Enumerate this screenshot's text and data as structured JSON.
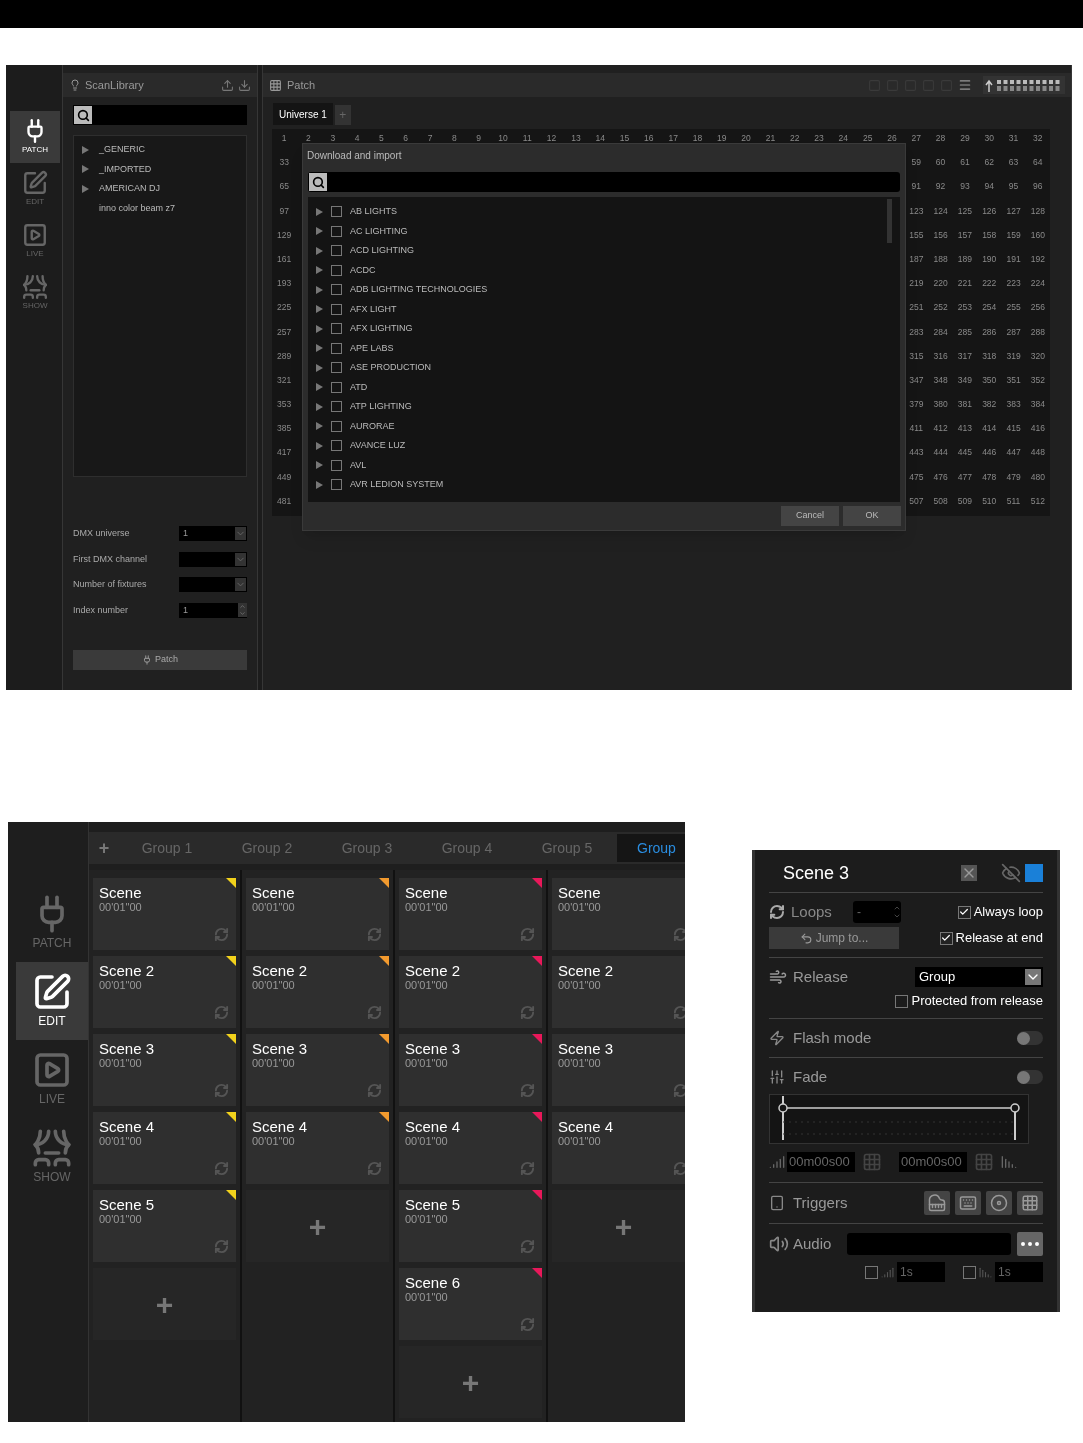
{
  "patch_screen": {
    "nav": [
      {
        "label": "PATCH",
        "selected": true
      },
      {
        "label": "EDIT",
        "selected": false
      },
      {
        "label": "LIVE",
        "selected": false
      },
      {
        "label": "SHOW",
        "selected": false
      }
    ],
    "library": {
      "title": "ScanLibrary",
      "tree": [
        {
          "label": "_GENERIC",
          "expandable": true
        },
        {
          "label": "_IMPORTED",
          "expandable": true
        },
        {
          "label": "AMERICAN DJ",
          "expandable": true
        },
        {
          "label": "inno color beam z7",
          "expandable": false
        }
      ],
      "fields": [
        {
          "label": "DMX universe",
          "value": "1",
          "kind": "dropdown"
        },
        {
          "label": "First DMX channel",
          "kind": "dropdown"
        },
        {
          "label": "Number of fixtures",
          "kind": "dropdown"
        },
        {
          "label": "Index number",
          "value": "1",
          "kind": "spinner"
        }
      ],
      "patch_button": "Patch"
    },
    "patch": {
      "title": "Patch",
      "universe_tabs": [
        {
          "label": "Universe 1",
          "selected": true
        }
      ],
      "add_tab": "+",
      "grid_rows": [
        [
          "1",
          "2",
          "3",
          "4",
          "5",
          "6",
          "7",
          "8",
          "9",
          "10",
          "11",
          "12",
          "13",
          "14",
          "15",
          "16",
          "17",
          "18",
          "19",
          "20",
          "21",
          "22",
          "23",
          "24",
          "25",
          "26",
          "27",
          "28",
          "29",
          "30",
          "31",
          "32"
        ],
        [
          "33",
          "59",
          "60",
          "61",
          "62",
          "63",
          "64"
        ],
        [
          "65",
          "91",
          "92",
          "93",
          "94",
          "95",
          "96"
        ],
        [
          "97",
          "123",
          "124",
          "125",
          "126",
          "127",
          "128"
        ],
        [
          "129",
          "155",
          "156",
          "157",
          "158",
          "159",
          "160"
        ],
        [
          "161",
          "187",
          "188",
          "189",
          "190",
          "191",
          "192"
        ],
        [
          "193",
          "219",
          "220",
          "221",
          "222",
          "223",
          "224"
        ],
        [
          "225",
          "251",
          "252",
          "253",
          "254",
          "255",
          "256"
        ],
        [
          "257",
          "283",
          "284",
          "285",
          "286",
          "287",
          "288"
        ],
        [
          "289",
          "315",
          "316",
          "317",
          "318",
          "319",
          "320"
        ],
        [
          "321",
          "347",
          "348",
          "349",
          "350",
          "351",
          "352"
        ],
        [
          "353",
          "379",
          "380",
          "381",
          "382",
          "383",
          "384"
        ],
        [
          "385",
          "411",
          "412",
          "413",
          "414",
          "415",
          "416"
        ],
        [
          "417",
          "443",
          "444",
          "445",
          "446",
          "447",
          "448"
        ],
        [
          "449",
          "475",
          "476",
          "477",
          "478",
          "479",
          "480"
        ],
        [
          "481",
          "507",
          "508",
          "509",
          "510",
          "511",
          "512"
        ]
      ],
      "dialog": {
        "title": "Download and import",
        "items": [
          {
            "label": "AB LIGHTS",
            "checked": false
          },
          {
            "label": "AC LIGHTING",
            "checked": false
          },
          {
            "label": "ACD LIGHTING",
            "checked": false
          },
          {
            "label": "ACDC",
            "checked": false
          },
          {
            "label": "ADB LIGHTING TECHNOLOGIES",
            "checked": false
          },
          {
            "label": "AFX LIGHT",
            "checked": false
          },
          {
            "label": "AFX LIGHTING",
            "checked": false
          },
          {
            "label": "APE LABS",
            "checked": false
          },
          {
            "label": "ASE PRODUCTION",
            "checked": false
          },
          {
            "label": "ATD",
            "checked": false
          },
          {
            "label": "ATP LIGHTING",
            "checked": false
          },
          {
            "label": "AURORAE",
            "checked": false
          },
          {
            "label": "AVANCE LUZ",
            "checked": false
          },
          {
            "label": "AVL",
            "checked": false
          },
          {
            "label": "AVR LEDION SYSTEM",
            "checked": false
          }
        ],
        "buttons": [
          "Cancel",
          "OK"
        ]
      }
    }
  },
  "scenes_screen": {
    "nav": [
      {
        "label": "PATCH",
        "selected": false
      },
      {
        "label": "EDIT",
        "selected": true
      },
      {
        "label": "LIVE",
        "selected": false
      },
      {
        "label": "SHOW",
        "selected": false
      }
    ],
    "add_group": "+",
    "group_tabs": [
      {
        "label": "Group 1",
        "selected": false
      },
      {
        "label": "Group 2",
        "selected": false
      },
      {
        "label": "Group 3",
        "selected": false
      },
      {
        "label": "Group 4",
        "selected": false
      },
      {
        "label": "Group 5",
        "selected": false
      },
      {
        "label": "Group",
        "selected": true
      }
    ],
    "columns": [
      {
        "color": "#f2d21c",
        "scenes": [
          {
            "name": "Scene",
            "time": "00'01\"00"
          },
          {
            "name": "Scene 2",
            "time": "00'01\"00"
          },
          {
            "name": "Scene 3",
            "time": "00'01\"00"
          },
          {
            "name": "Scene 4",
            "time": "00'01\"00"
          },
          {
            "name": "Scene 5",
            "time": "00'01\"00"
          }
        ],
        "add": "+"
      },
      {
        "color": "#f29a2e",
        "scenes": [
          {
            "name": "Scene",
            "time": "00'01\"00"
          },
          {
            "name": "Scene 2",
            "time": "00'01\"00"
          },
          {
            "name": "Scene 3",
            "time": "00'01\"00"
          },
          {
            "name": "Scene 4",
            "time": "00'01\"00"
          }
        ],
        "add": "+"
      },
      {
        "color": "#e8185a",
        "scenes": [
          {
            "name": "Scene",
            "time": "00'01\"00"
          },
          {
            "name": "Scene 2",
            "time": "00'01\"00"
          },
          {
            "name": "Scene 3",
            "time": "00'01\"00"
          },
          {
            "name": "Scene 4",
            "time": "00'01\"00"
          },
          {
            "name": "Scene 5",
            "time": "00'01\"00"
          },
          {
            "name": "Scene 6",
            "time": "00'01\"00"
          }
        ],
        "add": "+"
      },
      {
        "scenes": [
          {
            "name": "Scene",
            "time": "00'01\"00"
          },
          {
            "name": "Scene 2",
            "time": "00'01\"00"
          },
          {
            "name": "Scene 3",
            "time": "00'01\"00"
          },
          {
            "name": "Scene 4",
            "time": "00'01\"00"
          }
        ],
        "add": "+"
      }
    ]
  },
  "scene_panel": {
    "title": "Scene 3",
    "color": "#1a80d8",
    "loops": {
      "label": "Loops",
      "value": "-",
      "jump_button": "Jump to...",
      "always_loop": {
        "label": "Always loop",
        "checked": true
      },
      "release_at_end": {
        "label": "Release at end",
        "checked": true
      }
    },
    "release": {
      "label": "Release",
      "value": "Group",
      "protected": {
        "label": "Protected from release",
        "checked": false
      }
    },
    "flash_mode": {
      "label": "Flash mode",
      "on": false
    },
    "fade": {
      "label": "Fade",
      "on": false,
      "fade_in": "00m00s00",
      "fade_out": "00m00s00"
    },
    "triggers": {
      "label": "Triggers"
    },
    "audio": {
      "label": "Audio",
      "fade_in": {
        "checked": false,
        "value": "1s"
      },
      "fade_out": {
        "checked": false,
        "value": "1s"
      }
    }
  }
}
